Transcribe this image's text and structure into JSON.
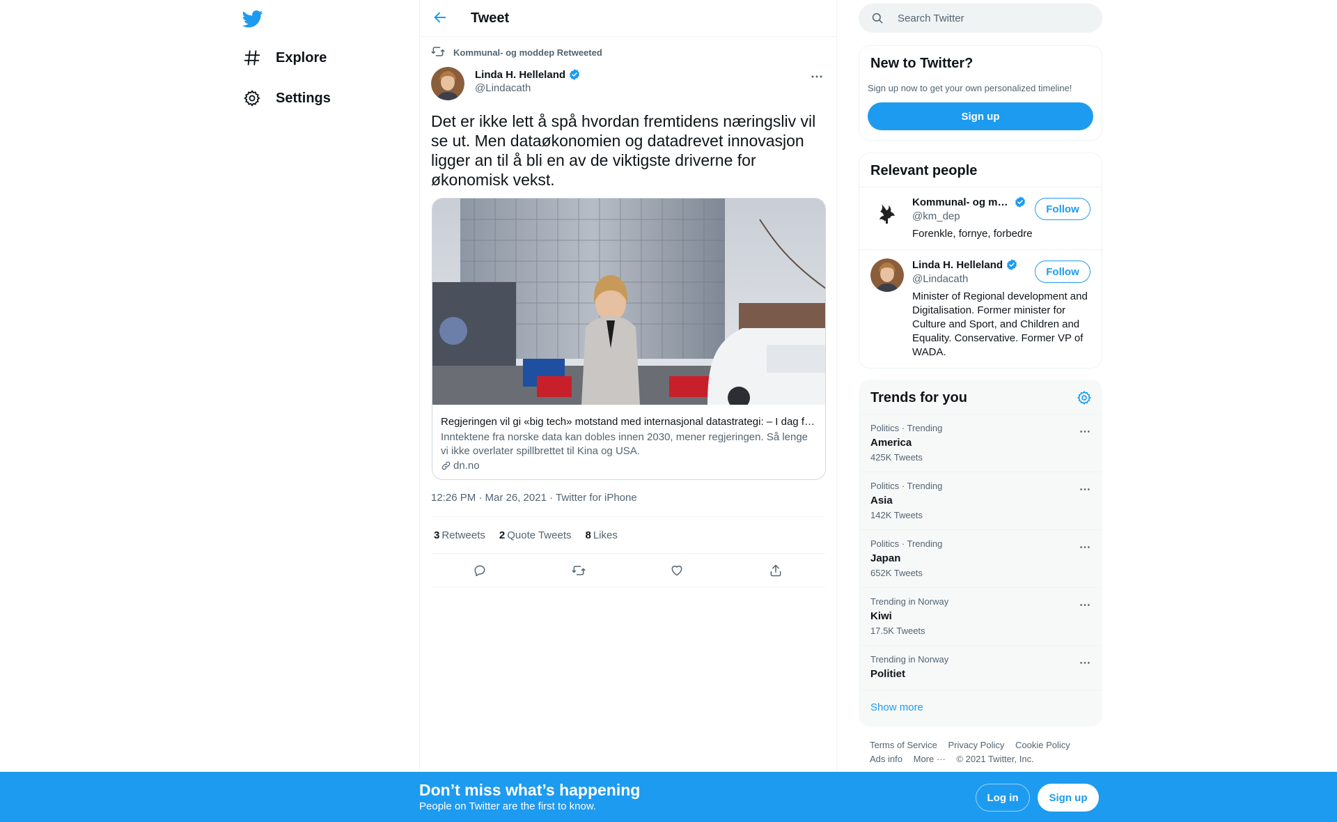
{
  "colors": {
    "accent": "#1d9bf0",
    "text_primary": "#0f1419",
    "text_secondary": "#536471",
    "border": "#eff3f4",
    "panel_bg": "#f7f9f9"
  },
  "nav": {
    "logo_icon": "twitter-bird-icon",
    "items": [
      {
        "label": "Explore",
        "icon": "hashtag-icon"
      },
      {
        "label": "Settings",
        "icon": "gear-icon"
      }
    ]
  },
  "header": {
    "title": "Tweet",
    "back_icon": "back-arrow-icon"
  },
  "tweet": {
    "retweeted_by": "Kommunal- og moddep Retweeted",
    "author": {
      "name": "Linda H. Helleland",
      "handle": "@Lindacath",
      "verified": true
    },
    "text": "Det er ikke lett å spå hvordan fremtidens næringsliv vil se ut. Men dataøkonomien og datadrevet innovasjon ligger an til å bli en av de viktigste driverne for økonomisk vekst.",
    "card": {
      "title": "Regjeringen vil gi «big tech» motstand med internasjonal datastrategi: – I dag f…",
      "description": "Inntektene fra norske data kan dobles innen 2030, mener regjeringen. Så lenge vi ikke overlater spillbrettet til Kina og USA.",
      "domain": "dn.no"
    },
    "timestamp": "12:26 PM · Mar 26, 2021 · Twitter for iPhone",
    "stats": [
      {
        "count": "3",
        "label": "Retweets"
      },
      {
        "count": "2",
        "label": "Quote Tweets"
      },
      {
        "count": "8",
        "label": "Likes"
      }
    ]
  },
  "search": {
    "placeholder": "Search Twitter"
  },
  "new_to_twitter": {
    "title": "New to Twitter?",
    "subtitle": "Sign up now to get your own personalized timeline!",
    "button": "Sign up"
  },
  "relevant_people": {
    "title": "Relevant people",
    "people": [
      {
        "name": "Kommunal- og m…",
        "handle": "@km_dep",
        "bio": "Forenkle, fornye, forbedre",
        "button": "Follow"
      },
      {
        "name": "Linda H. Helleland",
        "handle": "@Lindacath",
        "bio": "Minister of Regional development and Digitalisation. Former minister for Culture and Sport, and Children and Equality. Conservative. Former VP of WADA.",
        "button": "Follow"
      }
    ]
  },
  "trends": {
    "title": "Trends for you",
    "items": [
      {
        "context": "Politics · Trending",
        "name": "America",
        "count": "425K Tweets"
      },
      {
        "context": "Politics · Trending",
        "name": "Asia",
        "count": "142K Tweets"
      },
      {
        "context": "Politics · Trending",
        "name": "Japan",
        "count": "652K Tweets"
      },
      {
        "context": "Trending in Norway",
        "name": "Kiwi",
        "count": "17.5K Tweets"
      },
      {
        "context": "Trending in Norway",
        "name": "Politiet",
        "count": ""
      }
    ],
    "show_more": "Show more"
  },
  "footer": {
    "links": [
      "Terms of Service",
      "Privacy Policy",
      "Cookie Policy",
      "Ads info",
      "More ···"
    ],
    "copyright": "© 2021 Twitter, Inc."
  },
  "bottom_bar": {
    "title": "Don’t miss what’s happening",
    "subtitle": "People on Twitter are the first to know.",
    "login": "Log in",
    "signup": "Sign up"
  }
}
